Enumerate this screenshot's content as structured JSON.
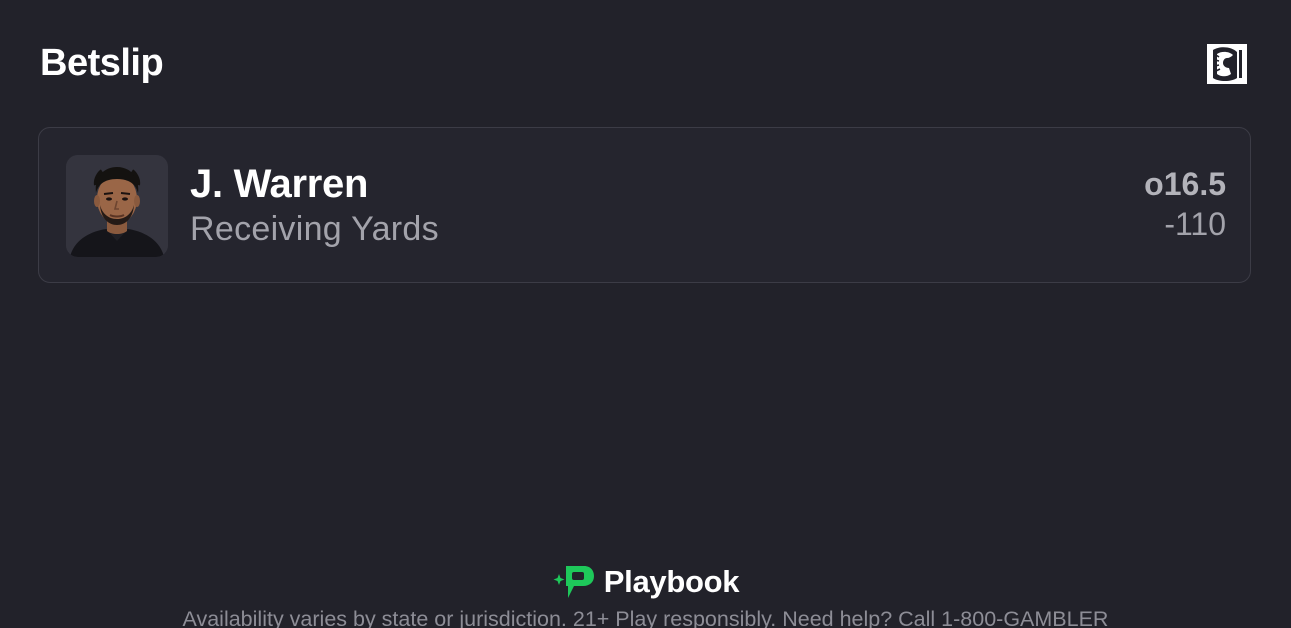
{
  "header": {
    "title": "Betslip",
    "brand_icon": "lion-logo-icon"
  },
  "bet": {
    "player_name": "J. Warren",
    "market": "Receiving Yards",
    "line": "o16.5",
    "odds": "-110",
    "avatar_icon": "player-headshot"
  },
  "footer": {
    "brand_name": "Playbook",
    "brand_icon": "playbook-logo-icon",
    "disclaimer": "Availability varies by state or jurisdiction. 21+ Play responsibly. Need help? Call 1-800-GAMBLER",
    "accent_color": "#1ec85a"
  }
}
